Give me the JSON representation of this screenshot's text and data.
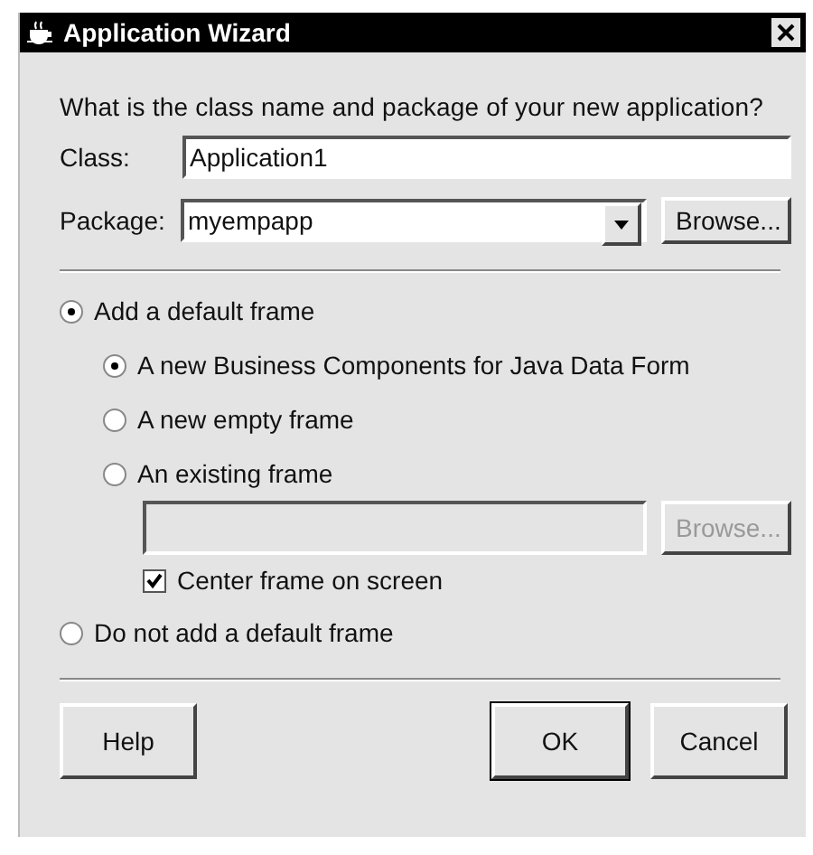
{
  "window": {
    "title": "Application Wizard"
  },
  "prompt": "What is the class name and package of your new application?",
  "class_field": {
    "label": "Class:",
    "value": "Application1"
  },
  "package_field": {
    "label": "Package:",
    "value": "myempapp",
    "browse": "Browse..."
  },
  "frame_modes": [
    {
      "label": "Add a default frame",
      "selected": true,
      "sub_options": [
        {
          "label": "A new Business Components for Java Data Form",
          "selected": true
        },
        {
          "label": "A new empty frame",
          "selected": false
        },
        {
          "label": "An existing frame",
          "selected": false
        }
      ],
      "existing_frame": {
        "disabled": true,
        "browse": "Browse..."
      },
      "center": {
        "label": "Center frame on screen",
        "checked": true
      }
    },
    {
      "label": "Do not add a default frame",
      "selected": false
    }
  ],
  "buttons": [
    {
      "label": "Help",
      "default": false
    },
    {
      "label": "OK",
      "default": true
    },
    {
      "label": "Cancel",
      "default": false
    }
  ]
}
